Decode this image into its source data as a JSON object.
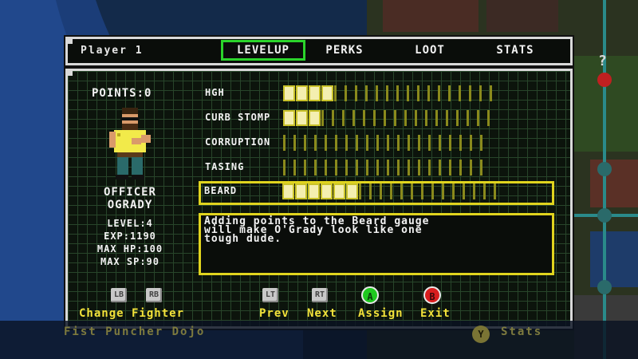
{
  "top_bar": {
    "player_label": "Player 1",
    "tabs": [
      {
        "label": "LEVELUP",
        "active": true
      },
      {
        "label": "PERKS",
        "active": false
      },
      {
        "label": "LOOT",
        "active": false
      },
      {
        "label": "STATS",
        "active": false
      }
    ]
  },
  "character": {
    "points_label": "POINTS:0",
    "name_line1": "OFFICER",
    "name_line2": "OGRADY",
    "level": "LEVEL:4",
    "exp": "EXP:1190",
    "max_hp": "MAX HP:100",
    "max_sp": "MAX SP:90"
  },
  "skills": [
    {
      "label": "HGH",
      "filled": 4,
      "total": 20,
      "selected": false
    },
    {
      "label": "CURB STOMP",
      "filled": 3,
      "total": 20,
      "selected": false
    },
    {
      "label": "CORRUPTION",
      "filled": 0,
      "total": 20,
      "selected": false
    },
    {
      "label": "TASING",
      "filled": 0,
      "total": 20,
      "selected": false
    },
    {
      "label": "BEARD",
      "filled": 6,
      "total": 20,
      "selected": true
    }
  ],
  "description": {
    "line1": "Adding points to the Beard gauge",
    "line2": "will make O'Grady look like one",
    "line3": "tough dude."
  },
  "button_hints": {
    "lb": "LB",
    "rb": "RB",
    "lt": "LT",
    "rt": "RT",
    "a": "A",
    "b": "B",
    "change_fighter": "Change Fighter",
    "prev": "Prev",
    "next": "Next",
    "assign": "Assign",
    "exit": "Exit"
  },
  "bottom_bar": {
    "location": "Fist Puncher Dojo",
    "y_button": "Y",
    "stats": "Stats"
  },
  "colors": {
    "accent_green": "#2bd42b",
    "accent_yellow": "#e0d41e",
    "a_button": "#1ec81e",
    "b_button": "#d81e1e"
  }
}
